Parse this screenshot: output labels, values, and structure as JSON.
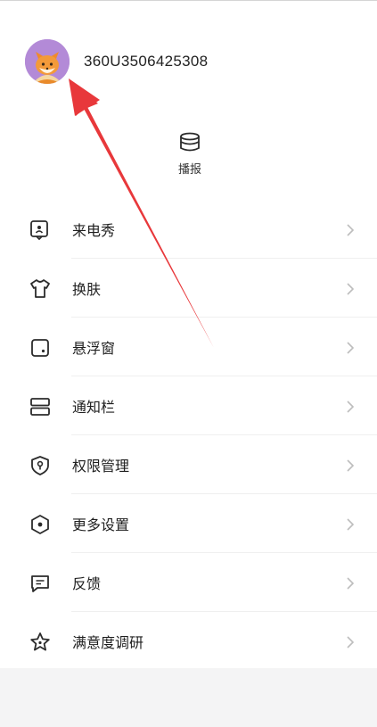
{
  "profile": {
    "username": "360U3506425308",
    "avatar_icon": "fox-avatar"
  },
  "broadcast": {
    "label": "播报",
    "icon": "database-stack-icon"
  },
  "menu": {
    "items": [
      {
        "label": "来电秀",
        "icon": "incoming-call-show-icon"
      },
      {
        "label": "换肤",
        "icon": "tshirt-icon"
      },
      {
        "label": "悬浮窗",
        "icon": "floating-window-icon"
      },
      {
        "label": "通知栏",
        "icon": "notification-bar-icon"
      },
      {
        "label": "权限管理",
        "icon": "permission-shield-icon"
      },
      {
        "label": "更多设置",
        "icon": "settings-hexagon-icon"
      },
      {
        "label": "反馈",
        "icon": "feedback-icon"
      },
      {
        "label": "满意度调研",
        "icon": "star-icon"
      }
    ]
  },
  "colors": {
    "avatar_bg": "#b38ad7",
    "annotation_arrow": "#e8383b",
    "icon_stroke": "#2b2b2b",
    "chevron": "#bdbdbd"
  }
}
